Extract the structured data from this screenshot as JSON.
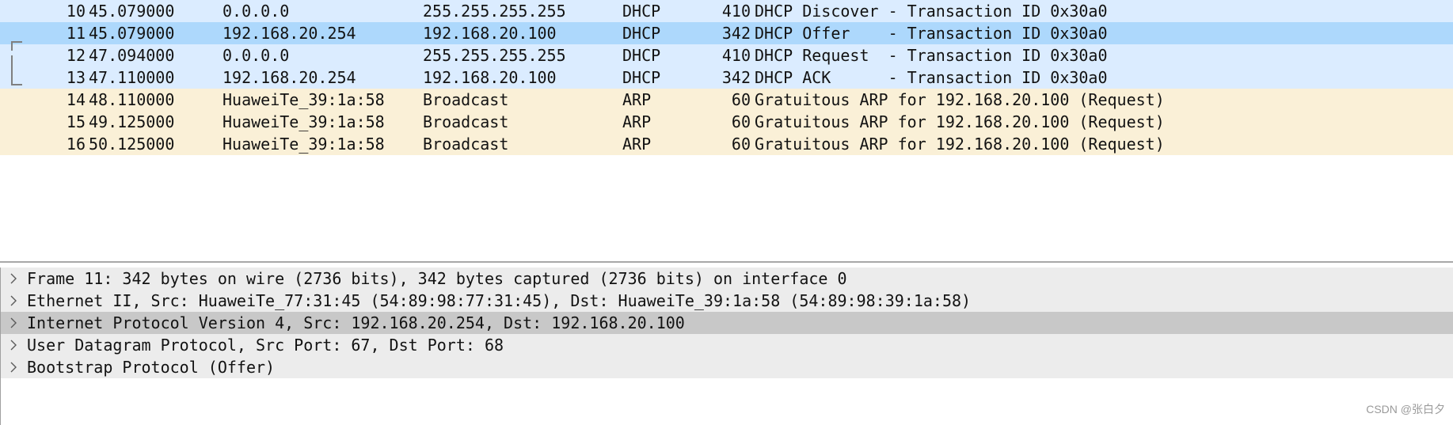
{
  "packets": [
    {
      "no": "10",
      "time": "45.079000",
      "source": "0.0.0.0",
      "destination": "255.255.255.255",
      "protocol": "DHCP",
      "length": "410",
      "info": "DHCP Discover - Transaction ID 0x30a0"
    },
    {
      "no": "11",
      "time": "45.079000",
      "source": "192.168.20.254",
      "destination": "192.168.20.100",
      "protocol": "DHCP",
      "length": "342",
      "info": "DHCP Offer    - Transaction ID 0x30a0"
    },
    {
      "no": "12",
      "time": "47.094000",
      "source": "0.0.0.0",
      "destination": "255.255.255.255",
      "protocol": "DHCP",
      "length": "410",
      "info": "DHCP Request  - Transaction ID 0x30a0"
    },
    {
      "no": "13",
      "time": "47.110000",
      "source": "192.168.20.254",
      "destination": "192.168.20.100",
      "protocol": "DHCP",
      "length": "342",
      "info": "DHCP ACK      - Transaction ID 0x30a0"
    },
    {
      "no": "14",
      "time": "48.110000",
      "source": "HuaweiTe_39:1a:58",
      "destination": "Broadcast",
      "protocol": "ARP",
      "length": "60",
      "info": "Gratuitous ARP for 192.168.20.100 (Request)"
    },
    {
      "no": "15",
      "time": "49.125000",
      "source": "HuaweiTe_39:1a:58",
      "destination": "Broadcast",
      "protocol": "ARP",
      "length": "60",
      "info": "Gratuitous ARP for 192.168.20.100 (Request)"
    },
    {
      "no": "16",
      "time": "50.125000",
      "source": "HuaweiTe_39:1a:58",
      "destination": "Broadcast",
      "protocol": "ARP",
      "length": "60",
      "info": "Gratuitous ARP for 192.168.20.100 (Request)"
    }
  ],
  "details": [
    {
      "text": "Frame 11: 342 bytes on wire (2736 bits), 342 bytes captured (2736 bits) on interface 0"
    },
    {
      "text": "Ethernet II, Src: HuaweiTe_77:31:45 (54:89:98:77:31:45), Dst: HuaweiTe_39:1a:58 (54:89:98:39:1a:58)"
    },
    {
      "text": "Internet Protocol Version 4, Src: 192.168.20.254, Dst: 192.168.20.100"
    },
    {
      "text": "User Datagram Protocol, Src Port: 67, Dst Port: 68"
    },
    {
      "text": "Bootstrap Protocol (Offer)"
    }
  ],
  "watermark": "CSDN @张白夕",
  "colors": {
    "selected_row": "#add8fc",
    "dhcp_row": "#dbecff",
    "arp_row": "#faf0d7",
    "detail_row": "#ececec",
    "detail_highlight": "#c8c8c8"
  },
  "icons": {
    "tree_expander": "chevron-right-icon",
    "conversation": "conversation-bracket-icon"
  }
}
